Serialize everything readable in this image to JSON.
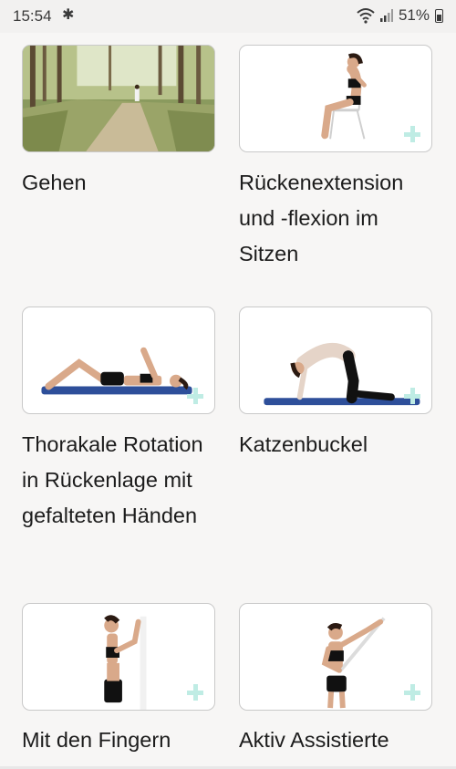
{
  "status_bar": {
    "time": "15:54",
    "battery": "51%"
  },
  "exercises": [
    {
      "title": "Gehen",
      "image": "forest-walk-photo"
    },
    {
      "title": "Rückenextension und -flexion im Sitzen",
      "image": "seated-chair-exercise"
    },
    {
      "title": "Thorakale Rotation in Rückenlage mit gefalteten Händen",
      "image": "supine-mat-exercise"
    },
    {
      "title": "Katzenbuckel",
      "image": "cat-cow-mat-exercise"
    },
    {
      "title": "Mit den Fingern",
      "image": "standing-wall-exercise"
    },
    {
      "title": "Aktiv Assistierte",
      "image": "stick-assisted-exercise"
    }
  ],
  "colors": {
    "background": "#f7f6f5",
    "plus_icon": "#bfece4",
    "mat": "#2e4f9a"
  }
}
